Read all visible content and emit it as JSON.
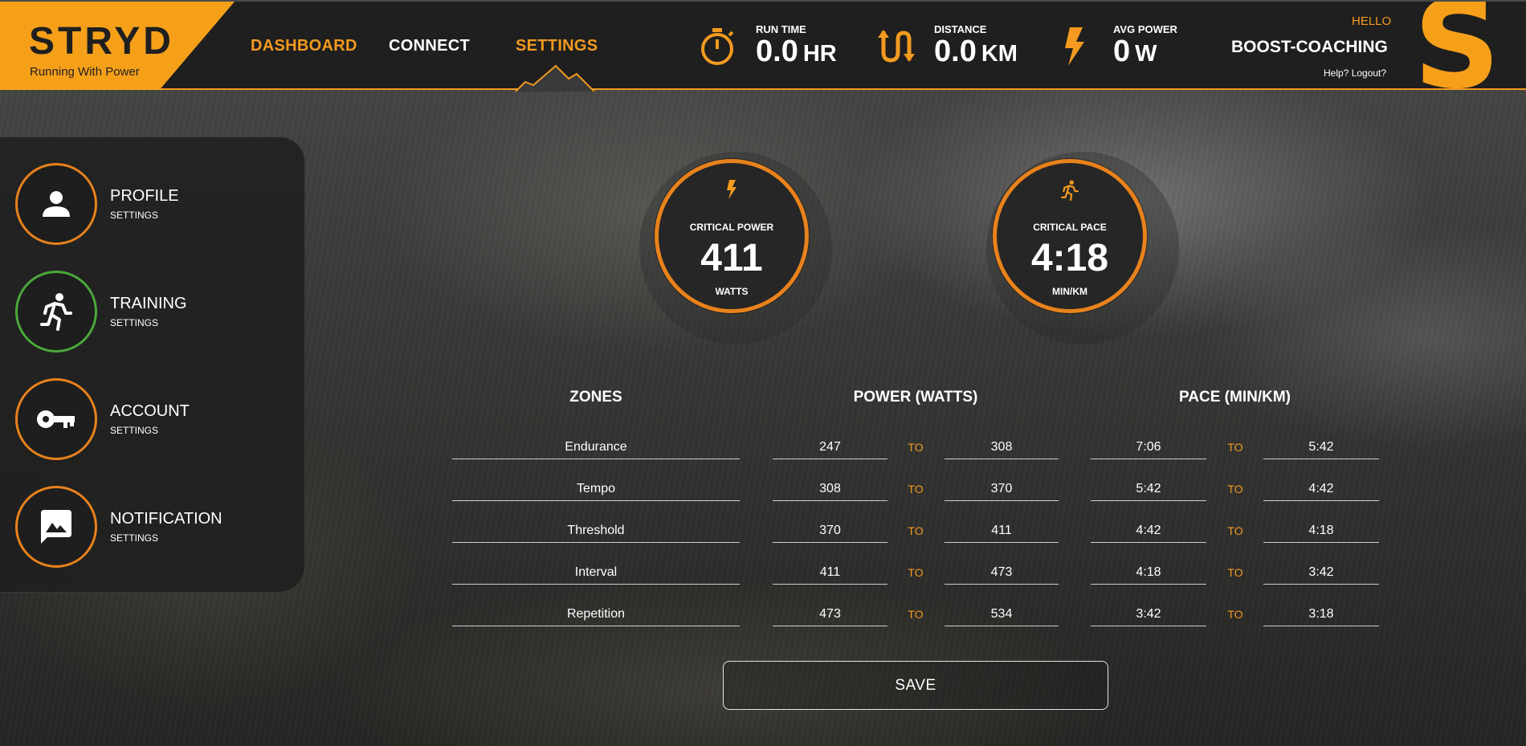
{
  "brand": {
    "name": "STRYD",
    "tagline": "Running With Power"
  },
  "nav": {
    "dashboard": "DASHBOARD",
    "connect": "CONNECT",
    "settings": "SETTINGS"
  },
  "stats": {
    "run_time": {
      "label": "RUN TIME",
      "value": "0.0",
      "unit": "HR",
      "icon": "stopwatch-icon"
    },
    "distance": {
      "label": "DISTANCE",
      "value": "0.0",
      "unit": "KM",
      "icon": "distance-arrows-icon"
    },
    "avg_power": {
      "label": "AVG POWER",
      "value": "0",
      "unit": "W",
      "icon": "lightning-icon"
    }
  },
  "user": {
    "hello": "HELLO",
    "name": "BOOST-COACHING",
    "links": "Help? Logout?",
    "logo_letter": "S"
  },
  "sidebar": {
    "items": [
      {
        "title": "PROFILE",
        "sub": "SETTINGS",
        "icon": "person-icon"
      },
      {
        "title": "TRAINING",
        "sub": "SETTINGS",
        "icon": "runner-icon"
      },
      {
        "title": "ACCOUNT",
        "sub": "SETTINGS",
        "icon": "key-icon"
      },
      {
        "title": "NOTIFICATION",
        "sub": "SETTINGS",
        "icon": "image-message-icon"
      }
    ]
  },
  "gauges": {
    "power": {
      "label": "CRITICAL POWER",
      "value": "411",
      "unit": "WATTS",
      "icon": "lightning-icon"
    },
    "pace": {
      "label": "CRITICAL PACE",
      "value": "4:18",
      "unit": "MIN/KM",
      "icon": "runner-icon"
    }
  },
  "zones": {
    "headers": {
      "zones": "ZONES",
      "power": "POWER (WATTS)",
      "pace": "PACE (MIN/KM)"
    },
    "to_label": "TO",
    "rows": [
      {
        "name": "Endurance",
        "power_from": "247",
        "power_to": "308",
        "pace_from": "7:06",
        "pace_to": "5:42"
      },
      {
        "name": "Tempo",
        "power_from": "308",
        "power_to": "370",
        "pace_from": "5:42",
        "pace_to": "4:42"
      },
      {
        "name": "Threshold",
        "power_from": "370",
        "power_to": "411",
        "pace_from": "4:42",
        "pace_to": "4:18"
      },
      {
        "name": "Interval",
        "power_from": "411",
        "power_to": "473",
        "pace_from": "4:18",
        "pace_to": "3:42"
      },
      {
        "name": "Repetition",
        "power_from": "473",
        "power_to": "534",
        "pace_from": "3:42",
        "pace_to": "3:18"
      }
    ]
  },
  "save_label": "SAVE",
  "colors": {
    "accent": "#f39a1f",
    "brand": "#f6a01a",
    "active_green": "#4aa83a",
    "header_bg": "#1f1f1f"
  }
}
